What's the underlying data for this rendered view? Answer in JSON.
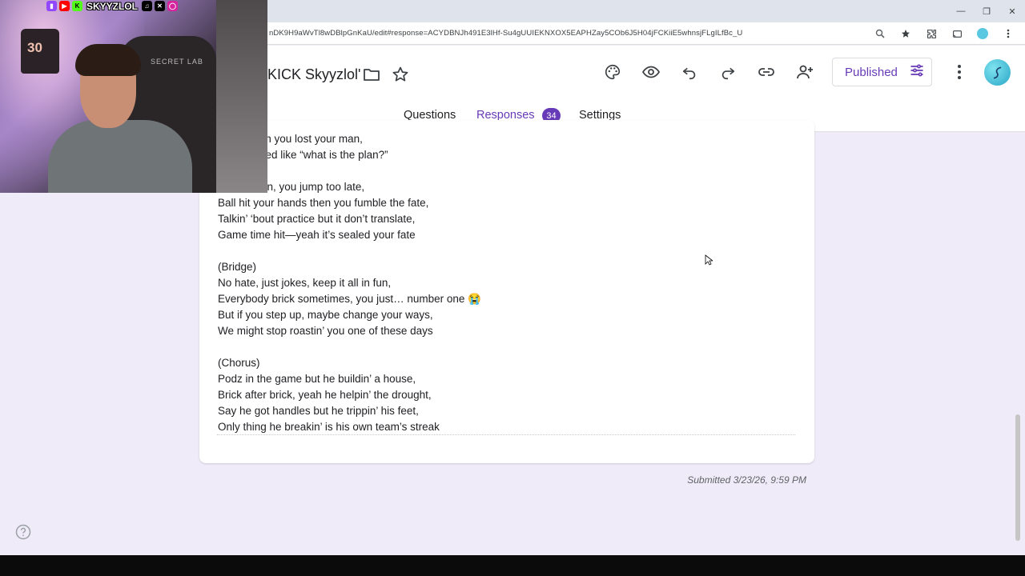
{
  "browser": {
    "url": "nDK9H9aWvTl8wDBlpGnKaU/edit#response=ACYDBNJh491E3lHf-Su4gUUIEKNXOX5EAPHZay5COb6J5H04jFCKiiE5whnsjFLgILfBc_U",
    "window_controls": [
      "minimize",
      "restore",
      "close"
    ]
  },
  "form": {
    "title": "KICK Skyyzlol'",
    "publish_label": "Published",
    "tabs": [
      {
        "label": "Questions"
      },
      {
        "label": "Responses",
        "badge": "34",
        "active": true
      },
      {
        "label": "Settings"
      }
    ]
  },
  "response": {
    "lyric_lines": [
      "he air, man you lost your man,",
      "kin’ stressed like “what is the plan?”",
      "",
      "come down, you jump too late,",
      "Ball hit your hands then you fumble the fate,",
      "Talkin’ ‘bout practice but it don’t translate,",
      "Game time hit—yeah it’s sealed your fate",
      "",
      "(Bridge)",
      "No hate, just jokes, keep it all in fun,",
      "Everybody brick sometimes, you just… number one 😭",
      "But if you step up, maybe change your ways,",
      "We might stop roastin’ you one of these days",
      "",
      "(Chorus)",
      "Podz in the game but he buildin’ a house,",
      "Brick after brick, yeah he helpin’ the drought,",
      "Say he got handles but he trippin’ his feet,",
      "Only thing he breakin’ is his own team’s streak"
    ],
    "submitted": "Submitted 3/23/26, 9:59 PM"
  },
  "webcam": {
    "handle": "SKYYZLOL",
    "jersey_number": "30",
    "chair_logo": "SECRET LAB"
  },
  "colors": {
    "accent": "#673ab7",
    "page_bg": "#f0ebf8"
  }
}
